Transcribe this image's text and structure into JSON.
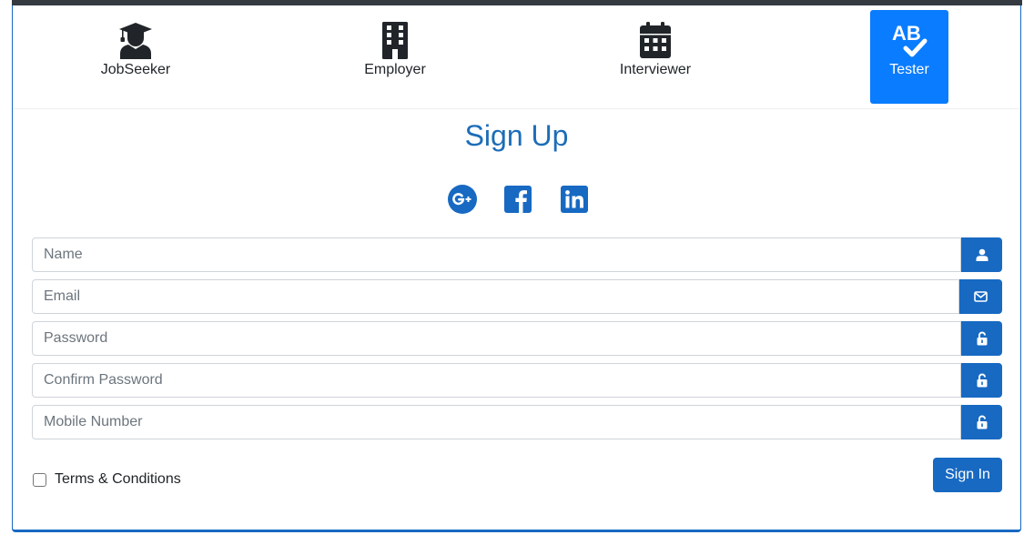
{
  "roles": [
    {
      "label": "JobSeeker",
      "icon": "graduate-icon",
      "active": false
    },
    {
      "label": "Employer",
      "icon": "building-icon",
      "active": false
    },
    {
      "label": "Interviewer",
      "icon": "calendar-icon",
      "active": false
    },
    {
      "label": "Tester",
      "icon": "ab-testing-check-icon",
      "active": true
    }
  ],
  "form": {
    "title": "Sign Up",
    "social": [
      "google-plus-icon",
      "facebook-icon",
      "linkedin-icon"
    ],
    "fields": {
      "name": {
        "placeholder": "Name",
        "icon": "user-icon"
      },
      "email": {
        "placeholder": "Email",
        "icon": "envelope-icon"
      },
      "password": {
        "placeholder": "Password",
        "icon": "unlock-icon"
      },
      "confirm_password": {
        "placeholder": "Confirm Password",
        "icon": "unlock-icon"
      },
      "mobile": {
        "placeholder": "Mobile Number",
        "icon": "unlock-icon"
      }
    },
    "terms_label": "Terms & Conditions",
    "terms_checked": false,
    "submit_label": "Sign In"
  },
  "colors": {
    "primary": "#1769c2",
    "active_tab": "#0a7cff",
    "title": "#1c6db8",
    "topbar": "#343a40"
  }
}
